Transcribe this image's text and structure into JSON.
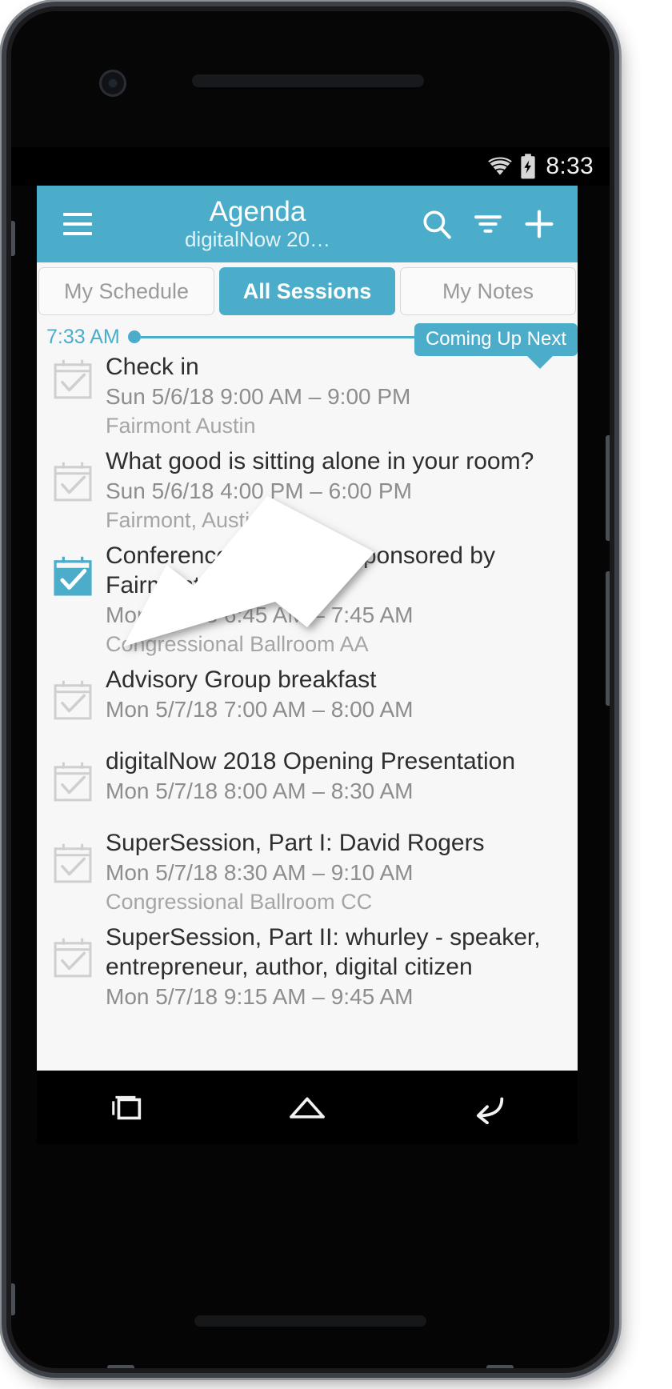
{
  "status_bar": {
    "time": "8:33",
    "wifi_icon": "wifi-icon",
    "battery_icon": "battery-charging-icon"
  },
  "app_bar": {
    "menu_icon": "hamburger-menu-icon",
    "title": "Agenda",
    "subtitle": "digitalNow 20…",
    "search_icon": "search-icon",
    "filter_icon": "filter-icon",
    "add_icon": "plus-icon",
    "background_color": "#4cadcb"
  },
  "tabs": [
    {
      "label": "My Schedule",
      "active": false
    },
    {
      "label": "All Sessions",
      "active": true
    },
    {
      "label": "My Notes",
      "active": false
    }
  ],
  "timeline": {
    "current_time": "7:33 AM",
    "badge_label": "Coming Up Next",
    "accent_color": "#4cadcb"
  },
  "sessions": [
    {
      "title": "Check in",
      "time": "Sun 5/6/18 9:00 AM – 9:00 PM",
      "location": "Fairmont Austin",
      "checked": false
    },
    {
      "title": "What good is sitting alone in your room?",
      "time": "Sun 5/6/18 4:00 PM – 6:00 PM",
      "location": "Fairmont, Austin",
      "checked": false
    },
    {
      "title": "Conference Breakfast, sponsored by Fairmont Austin",
      "time": "Mon 5/7/18 6:45 AM – 7:45 AM",
      "location": "Congressional Ballroom AA",
      "checked": true
    },
    {
      "title": "Advisory Group breakfast",
      "time": "Mon 5/7/18 7:00 AM – 8:00 AM",
      "location": "",
      "checked": false
    },
    {
      "title": "digitalNow 2018 Opening Presentation",
      "time": "Mon 5/7/18 8:00 AM – 8:30 AM",
      "location": "",
      "checked": false
    },
    {
      "title": "SuperSession, Part I: David Rogers",
      "time": "Mon 5/7/18 8:30 AM – 9:10 AM",
      "location": "Congressional Ballroom CC",
      "checked": false
    },
    {
      "title": "SuperSession, Part II: whurley - speaker, entrepreneur, author, digital citizen",
      "time": "Mon 5/7/18 9:15 AM – 9:45 AM",
      "location": "",
      "checked": false
    }
  ],
  "nav_bar": {
    "recents_icon": "recents-square-icon",
    "home_icon": "home-icon",
    "back_icon": "back-arrow-icon"
  },
  "annotation": {
    "arrow_icon": "pointer-arrow-icon",
    "arrow_color": "#ffffff"
  }
}
